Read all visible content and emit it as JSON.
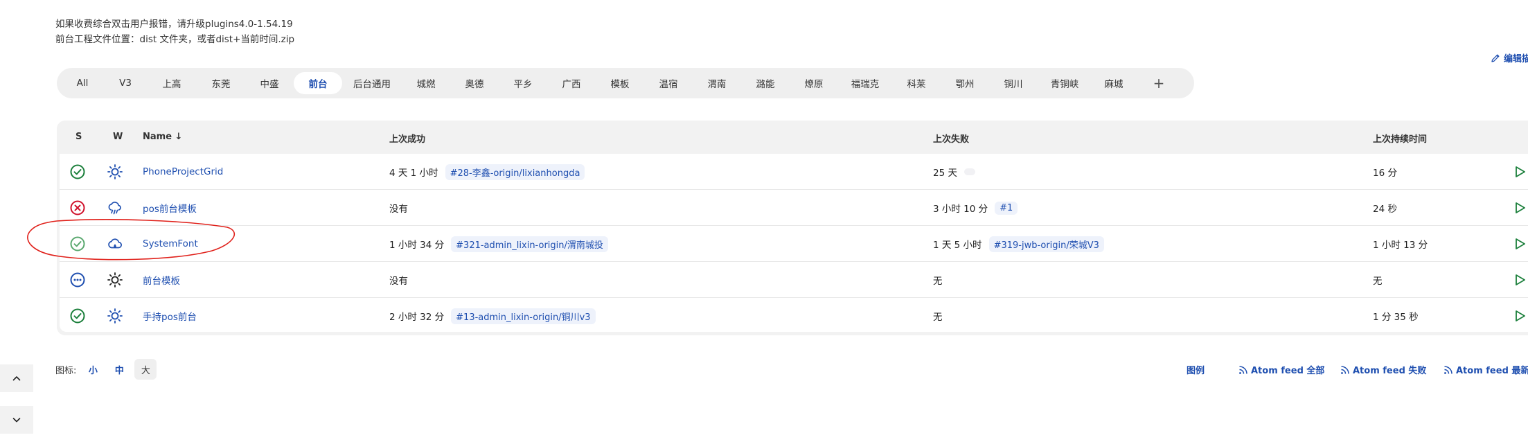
{
  "notice": {
    "line1": "如果收费综合双击用户报错，请升级plugins4.0-1.54.19",
    "line2": "前台工程文件位置：dist 文件夹，或者dist+当前时间.zip"
  },
  "edit_link": "编辑描",
  "tabs": [
    {
      "label": "All"
    },
    {
      "label": "V3"
    },
    {
      "label": "上高"
    },
    {
      "label": "东莞"
    },
    {
      "label": "中盛"
    },
    {
      "label": "前台",
      "active": true
    },
    {
      "label": "后台通用"
    },
    {
      "label": "城燃"
    },
    {
      "label": "奥德"
    },
    {
      "label": "平乡"
    },
    {
      "label": "广西"
    },
    {
      "label": "模板"
    },
    {
      "label": "温宿"
    },
    {
      "label": "渭南"
    },
    {
      "label": "潞能"
    },
    {
      "label": "燎原"
    },
    {
      "label": "福瑞克"
    },
    {
      "label": "科莱"
    },
    {
      "label": "鄂州"
    },
    {
      "label": "铜川"
    },
    {
      "label": "青铜峡"
    },
    {
      "label": "麻城"
    }
  ],
  "add_tab": "+",
  "table": {
    "headers": {
      "s": "S",
      "w": "W",
      "name": "Name ↓",
      "last_success": "上次成功",
      "last_failure": "上次失败",
      "last_duration": "上次持续时间"
    },
    "rows": [
      {
        "status": "success",
        "weather": "sunny",
        "name": "PhoneProjectGrid",
        "success_time": "4 天 1 小时",
        "success_build": "#28-李鑫-origin/lixianhongda",
        "failure_time": "25 天",
        "failure_build": "",
        "duration": "16 分"
      },
      {
        "status": "failed",
        "weather": "rain",
        "name": "pos前台模板",
        "success_time": "没有",
        "success_build": "",
        "failure_time": "3 小时 10 分",
        "failure_build": "#1",
        "duration": "24 秒"
      },
      {
        "status": "success",
        "weather": "cloudy",
        "name": "SystemFont",
        "success_time": "1 小时 34 分",
        "success_build": "#321-admin_lixin-origin/渭南城投",
        "failure_time": "1 天 5 小时",
        "failure_build": "#319-jwb-origin/荣城V3",
        "duration": "1 小时 13 分"
      },
      {
        "status": "notbuilt",
        "weather": "sunny",
        "name": "前台模板",
        "success_time": "没有",
        "success_build": "",
        "failure_time": "无",
        "failure_build": "",
        "duration": "无"
      },
      {
        "status": "success",
        "weather": "sunny",
        "name": "手持pos前台",
        "success_time": "2 小时 32 分",
        "success_build": "#13-admin_lixin-origin/铜川v3",
        "failure_time": "无",
        "failure_build": "",
        "duration": "1 分 35 秒"
      }
    ]
  },
  "icon_size": {
    "label": "图标:",
    "small": "小",
    "medium": "中",
    "large": "大"
  },
  "footer": {
    "legend": "图例",
    "feed_all": "Atom feed 全部",
    "feed_failed": "Atom feed 失败",
    "feed_latest": "Atom feed 最新的构"
  },
  "colors": {
    "link": "#1f4fb0",
    "success": "#1b7f3b",
    "failure": "#d0112b",
    "notbuilt": "#1f4fb0",
    "annotation": "#e0201a"
  }
}
